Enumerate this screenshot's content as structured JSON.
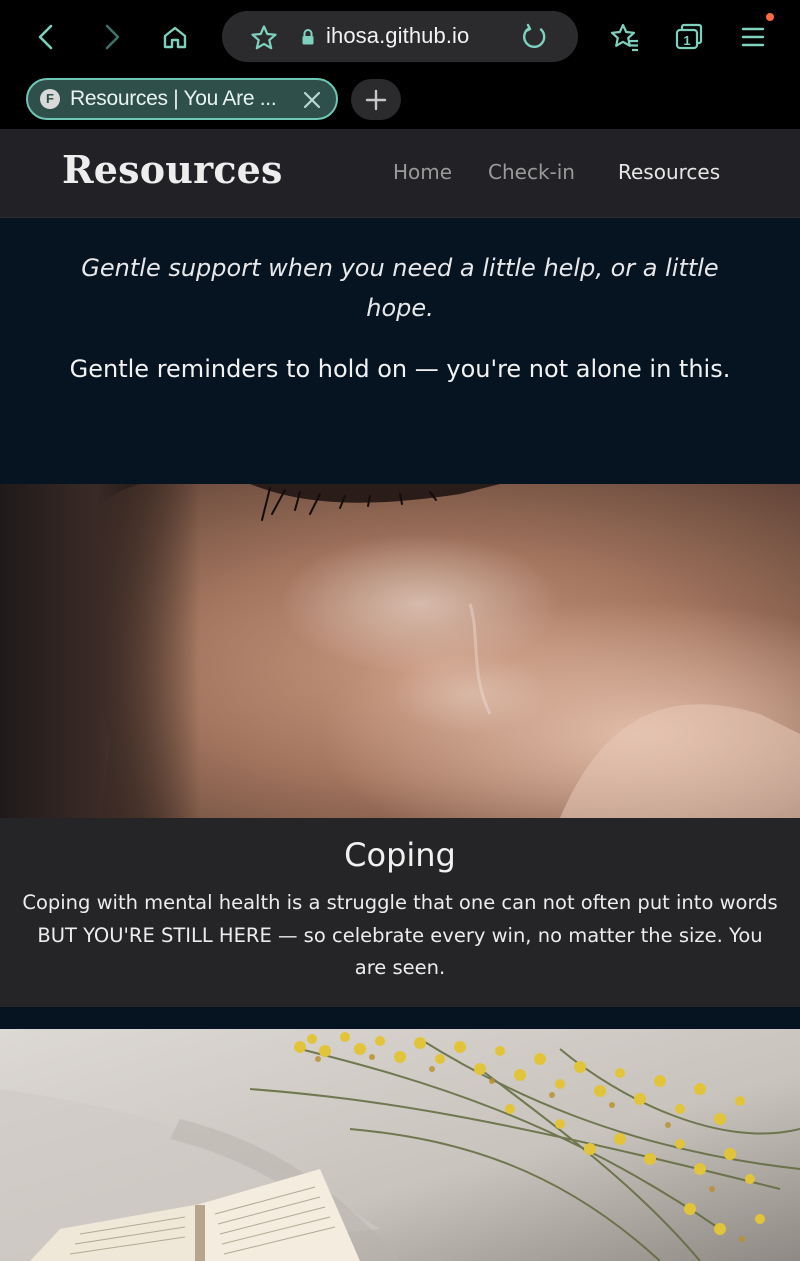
{
  "browser": {
    "url": "ihosa.github.io",
    "tab_title": "Resources | You Are ...",
    "tab_favicon_letter": "F",
    "tab_count": "1",
    "icons": [
      "back-icon",
      "forward-icon",
      "home-icon",
      "star-icon",
      "lock-icon",
      "reload-icon",
      "bookmarks-icon",
      "tabs-icon",
      "menu-icon",
      "close-icon",
      "plus-icon"
    ],
    "accent": "#6ec6b4",
    "notification_dot": "#ff6b3d"
  },
  "site": {
    "title": "Resources",
    "nav": [
      {
        "label": "Home",
        "active": false
      },
      {
        "label": "Check-in",
        "active": false
      },
      {
        "label": "Resources",
        "active": true
      }
    ]
  },
  "hero": {
    "tagline": "Gentle support when you need a little help, or a little hope.",
    "subtitle": "Gentle reminders to hold on — you're not alone in this."
  },
  "cards": [
    {
      "heading": "Coping",
      "text": "Coping with mental health is a struggle that one can not often put into words BUT YOU'RE STILL HERE — so celebrate every win, no matter the size. You are seen."
    }
  ]
}
